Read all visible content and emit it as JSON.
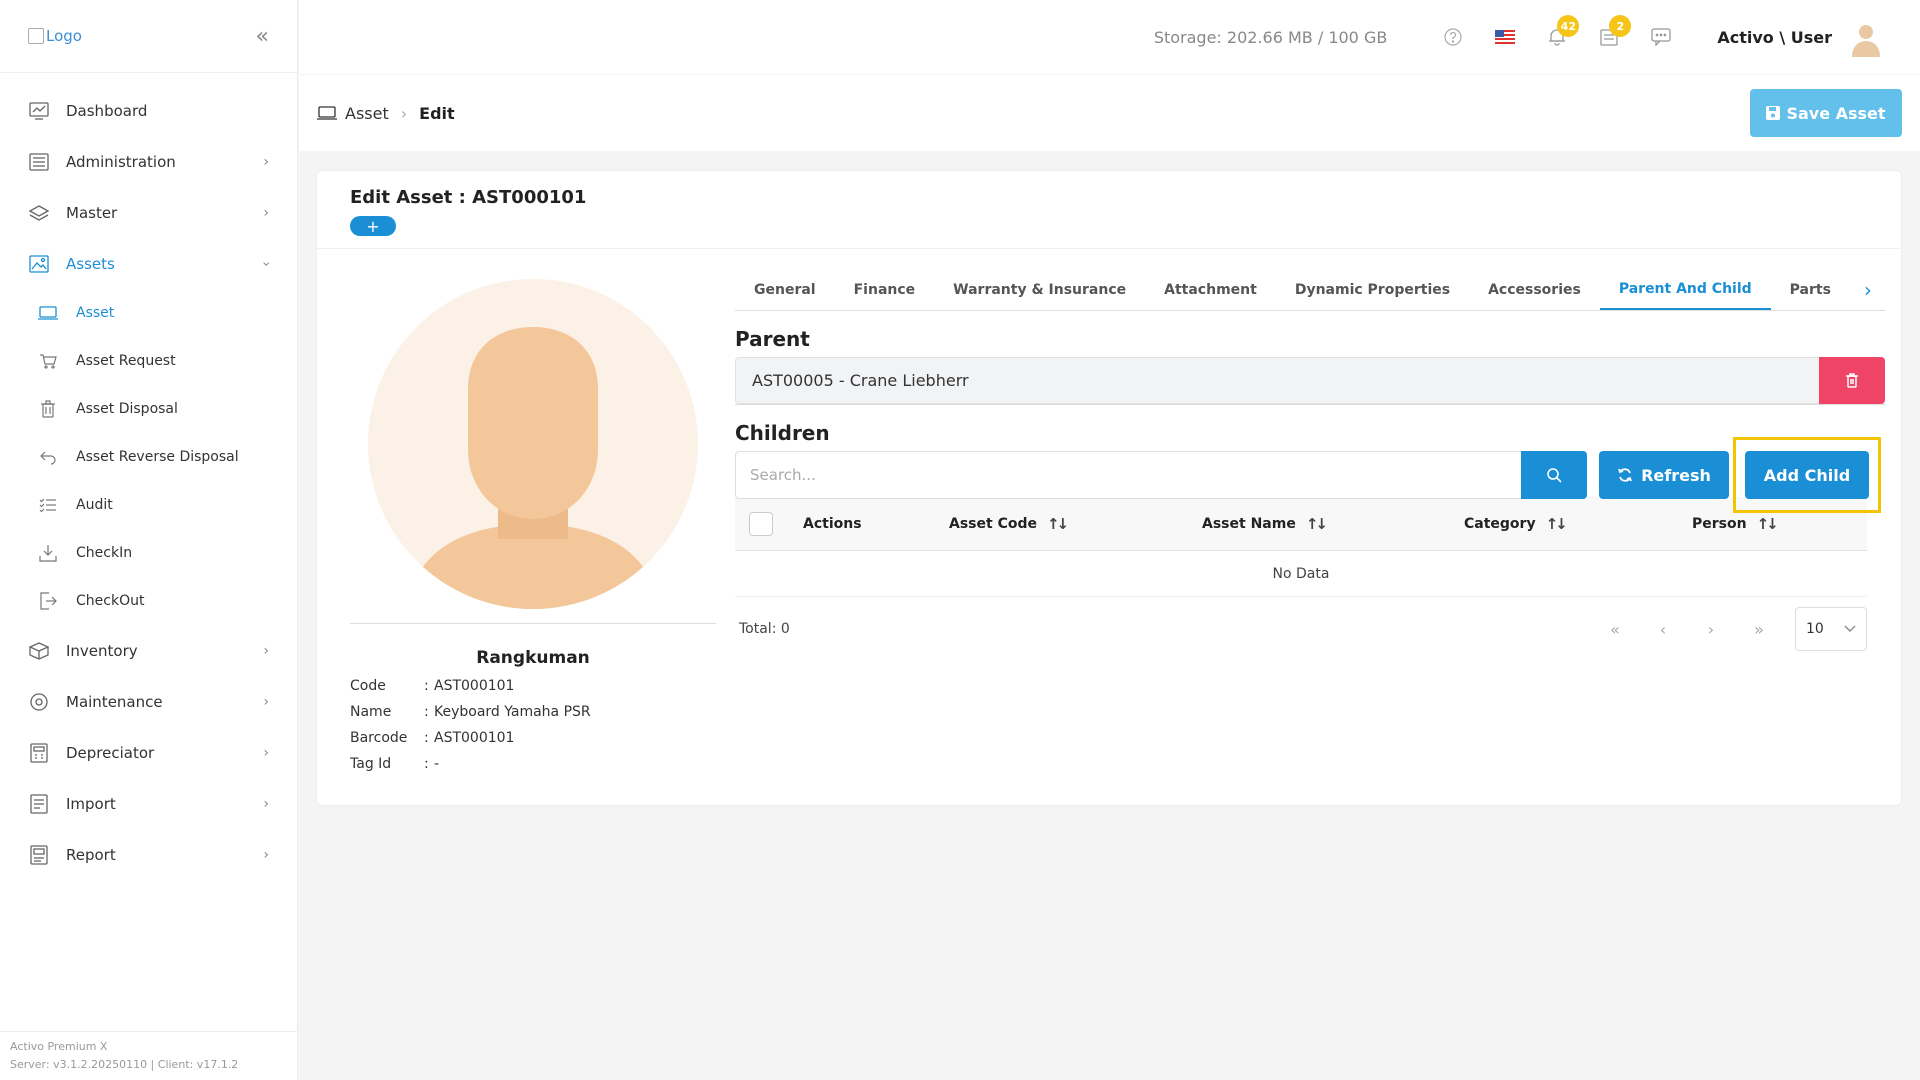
{
  "sidebar": {
    "logo_alt": "Logo",
    "collapse_glyph": "«",
    "items": [
      {
        "label": "Dashboard",
        "icon": "chart-line-icon"
      },
      {
        "label": "Administration",
        "icon": "sliders-icon"
      },
      {
        "label": "Master",
        "icon": "layers-icon"
      },
      {
        "label": "Assets",
        "icon": "image-icon"
      },
      {
        "label": "Inventory",
        "icon": "box-icon"
      },
      {
        "label": "Maintenance",
        "icon": "gear-icon"
      },
      {
        "label": "Depreciator",
        "icon": "calculator-icon"
      },
      {
        "label": "Import",
        "icon": "import-icon"
      },
      {
        "label": "Report",
        "icon": "report-icon"
      }
    ],
    "sub_items": [
      {
        "label": "Asset",
        "icon": "laptop-icon"
      },
      {
        "label": "Asset Request",
        "icon": "cart-icon"
      },
      {
        "label": "Asset Disposal",
        "icon": "trash-icon"
      },
      {
        "label": "Asset Reverse Disposal",
        "icon": "undo-icon"
      },
      {
        "label": "Audit",
        "icon": "list-check-icon"
      },
      {
        "label": "CheckIn",
        "icon": "download-icon"
      },
      {
        "label": "CheckOut",
        "icon": "sign-out-icon"
      }
    ],
    "footer_line1": "Activo Premium X",
    "footer_line2": "Server: v3.1.2.20250110 | Client: v17.1.2"
  },
  "topbar": {
    "storage": "Storage: 202.66 MB / 100 GB",
    "notifications_count": "42",
    "tasks_count": "2",
    "user_name": "Activo \\ User"
  },
  "breadcrumb": {
    "root": "Asset",
    "current": "Edit"
  },
  "save_button": "Save Asset",
  "card": {
    "title": "Edit Asset : AST000101",
    "plus_glyph": "+"
  },
  "summary": {
    "title": "Rangkuman",
    "rows": [
      {
        "key": "Code",
        "value": "AST000101"
      },
      {
        "key": "Name",
        "value": "Keyboard Yamaha PSR"
      },
      {
        "key": "Barcode",
        "value": "AST000101"
      },
      {
        "key": "Tag Id",
        "value": "-"
      }
    ]
  },
  "tabs": [
    "General",
    "Finance",
    "Warranty & Insurance",
    "Attachment",
    "Dynamic Properties",
    "Accessories",
    "Parent And Child",
    "Parts"
  ],
  "active_tab": "Parent And Child",
  "parent": {
    "title": "Parent",
    "value": "AST00005 - Crane Liebherr"
  },
  "children": {
    "title": "Children",
    "search_placeholder": "Search...",
    "refresh_label": "Refresh",
    "add_child_label": "Add Child",
    "columns": [
      "Actions",
      "Asset Code",
      "Asset Name",
      "Category",
      "Person"
    ],
    "rows": [],
    "no_data": "No Data",
    "total": "Total: 0",
    "page_size": "10"
  },
  "colors": {
    "accent": "#1a8fd5",
    "danger": "#ef4466",
    "highlight": "#f2c500",
    "badge": "#f6c518"
  }
}
